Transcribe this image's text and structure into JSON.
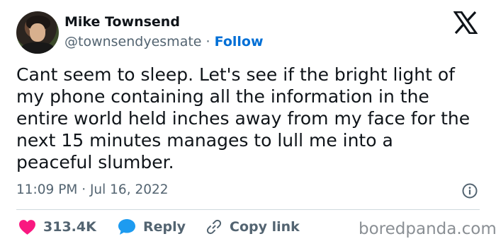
{
  "user": {
    "name": "Mike Townsend",
    "handle": "@townsendyesmate",
    "separator": "·",
    "follow_label": "Follow"
  },
  "tweet": {
    "lines": [
      "Cant seem to sleep. Let's see if the bright light of",
      "my phone containing all the information in the",
      "entire world held inches away from my face for the",
      "next 15 minutes manages to lull me into a",
      "peaceful slumber."
    ],
    "timestamp": "11:09 PM · Jul 16, 2022"
  },
  "actions": {
    "likes": "313.4K",
    "reply_label": "Reply",
    "copy_label": "Copy link"
  },
  "watermark": "boredpanda.com",
  "icons": {
    "like": "heart-icon",
    "reply": "speech-bubble-icon",
    "copy": "link-icon",
    "info": "info-icon",
    "brand": "x-logo-icon"
  },
  "colors": {
    "like": "#f91880",
    "reply": "#1d9bf0",
    "follow": "#006fd6",
    "secondary_text": "#536471"
  }
}
